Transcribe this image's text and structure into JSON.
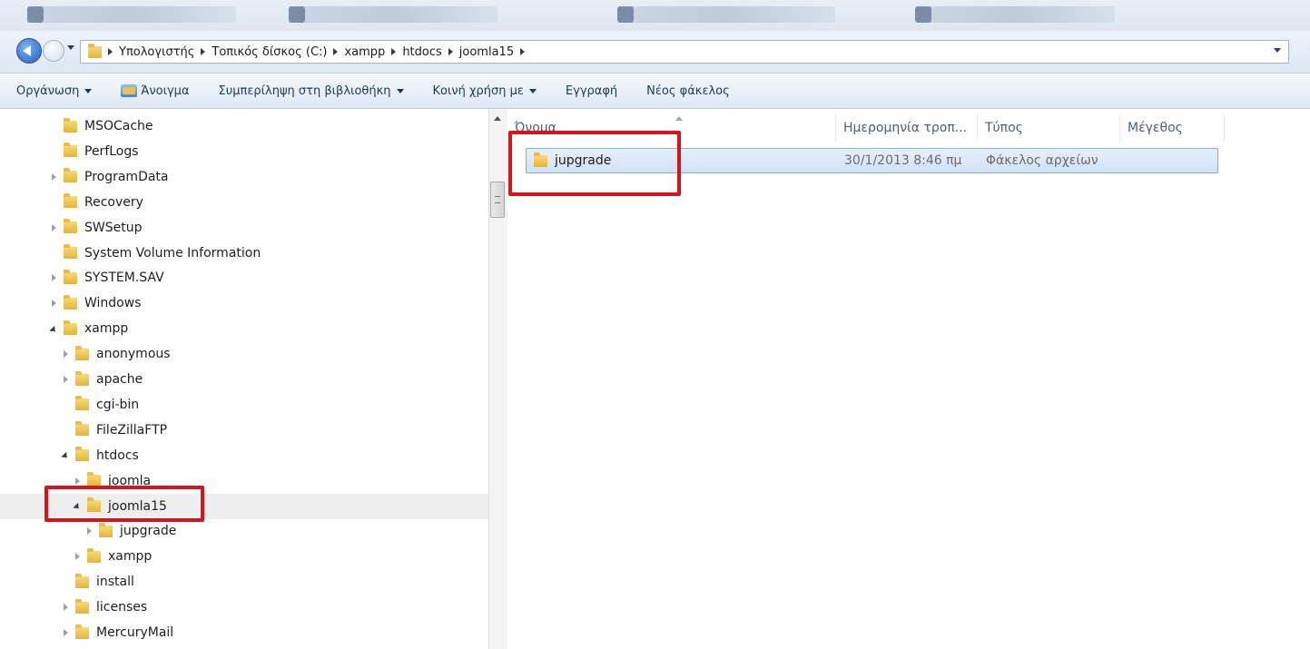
{
  "window_tabs": [
    {
      "label": ""
    },
    {
      "label": ""
    },
    {
      "label": ""
    },
    {
      "label": ""
    }
  ],
  "address": {
    "crumbs": [
      "Υπολογιστής",
      "Τοπικός δίσκος (C:)",
      "xampp",
      "htdocs",
      "joomla15"
    ]
  },
  "commands": [
    {
      "label": "Οργάνωση",
      "has_caret": true
    },
    {
      "label": "Άνοιγμα",
      "has_icon": true
    },
    {
      "label": "Συμπερίληψη στη βιβλιοθήκη",
      "has_caret": true
    },
    {
      "label": "Κοινή χρήση με",
      "has_caret": true
    },
    {
      "label": "Εγγραφή"
    },
    {
      "label": "Νέος φάκελος"
    }
  ],
  "tree": [
    {
      "label": "MSOCache",
      "arrow": "none",
      "level": 0
    },
    {
      "label": "PerfLogs",
      "arrow": "none",
      "level": 0
    },
    {
      "label": "ProgramData",
      "arrow": "closed",
      "level": 0
    },
    {
      "label": "Recovery",
      "arrow": "none",
      "level": 0
    },
    {
      "label": "SWSetup",
      "arrow": "closed",
      "level": 0
    },
    {
      "label": "System Volume Information",
      "arrow": "none",
      "level": 0
    },
    {
      "label": "SYSTEM.SAV",
      "arrow": "closed",
      "level": 0
    },
    {
      "label": "Windows",
      "arrow": "closed",
      "level": 0
    },
    {
      "label": "xampp",
      "arrow": "open",
      "level": 0
    },
    {
      "label": "anonymous",
      "arrow": "closed",
      "level": 1
    },
    {
      "label": "apache",
      "arrow": "closed",
      "level": 1
    },
    {
      "label": "cgi-bin",
      "arrow": "none",
      "level": 1
    },
    {
      "label": "FileZillaFTP",
      "arrow": "none",
      "level": 1
    },
    {
      "label": "htdocs",
      "arrow": "open",
      "level": 1
    },
    {
      "label": "joomla",
      "arrow": "closed",
      "level": 2
    },
    {
      "label": "joomla15",
      "arrow": "open",
      "level": 2,
      "selected": true
    },
    {
      "label": "jupgrade",
      "arrow": "closed",
      "level": 3
    },
    {
      "label": "xampp",
      "arrow": "closed",
      "level": 2
    },
    {
      "label": "install",
      "arrow": "none",
      "level": 1
    },
    {
      "label": "licenses",
      "arrow": "closed",
      "level": 1
    },
    {
      "label": "MercuryMail",
      "arrow": "closed",
      "level": 1
    }
  ],
  "columns": {
    "name": "Όνομα",
    "date": "Ημερομηνία τροπ...",
    "type": "Τύπος",
    "size": "Μέγεθος"
  },
  "files": [
    {
      "name": "jupgrade",
      "date": "30/1/2013 8:46 πμ",
      "type": "Φάκελος αρχείων",
      "size": ""
    }
  ],
  "colors": {
    "highlight": "#d6151b",
    "selection_border": "#84acdd"
  }
}
